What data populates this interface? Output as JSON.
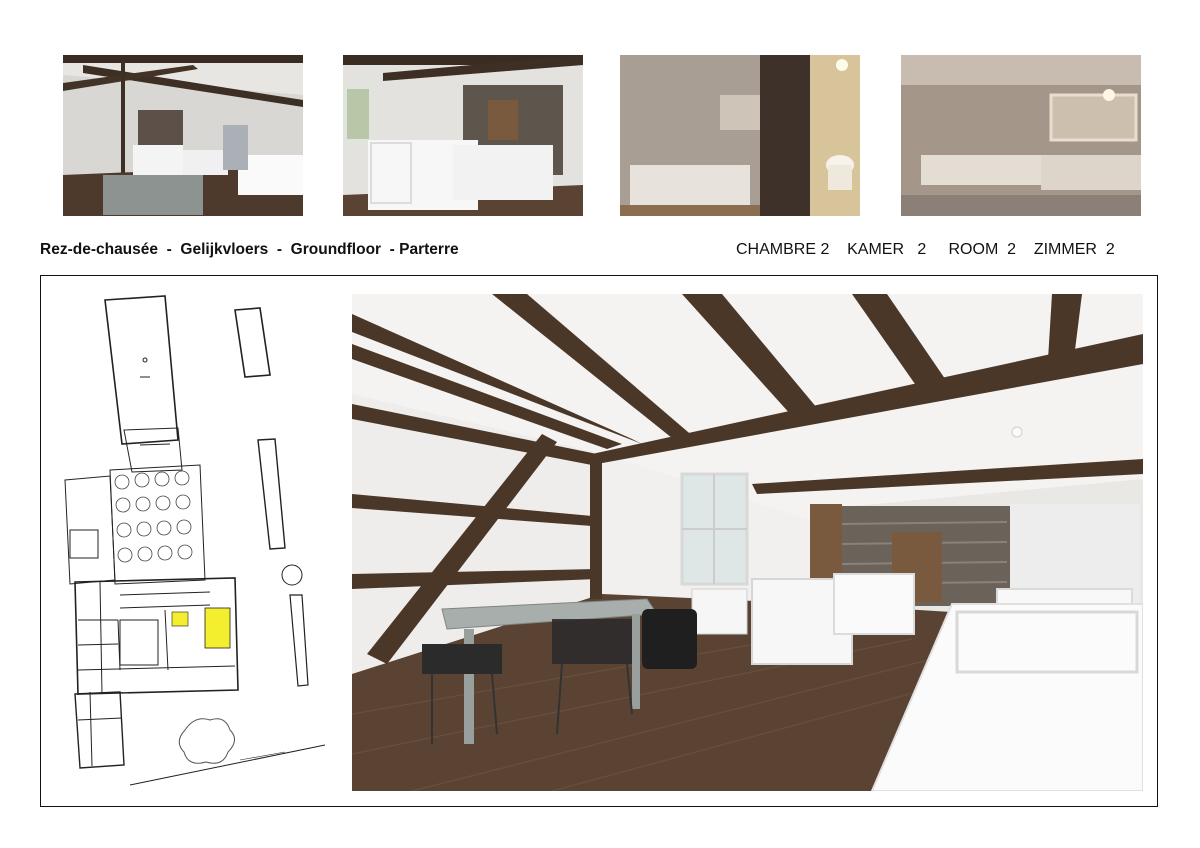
{
  "captions": {
    "floor_label": "Rez-de-chausée  -  Gelijkvloers  -  Groundfloor  - Parterre",
    "room_label": "CHAMBRE 2    KAMER   2     ROOM  2    ZIMMER  2"
  },
  "photos": [
    {
      "name": "bedroom-overview-photo"
    },
    {
      "name": "bedroom-beds-fireplace-photo"
    },
    {
      "name": "bathroom-toilet-photo"
    },
    {
      "name": "bathroom-bathtub-photo"
    }
  ],
  "plan": {
    "highlight_color": "#f3ee2e"
  },
  "colors": {
    "beam": "#4a3728",
    "floor": "#5a4332",
    "wall": "#f2f2f0",
    "stone": "#6b625a"
  }
}
